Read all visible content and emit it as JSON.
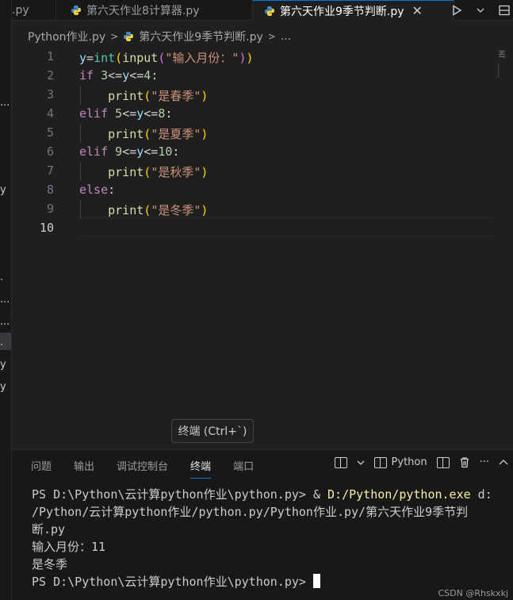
{
  "tabs": [
    {
      "label": ".py"
    },
    {
      "label": "第六天作业8计算器.py"
    },
    {
      "label": "第六天作业9季节判断.py",
      "active": true
    }
  ],
  "left_strip_fragments": [
    "...",
    "y",
    ".",
    "...",
    "...",
    ".",
    "y",
    "y"
  ],
  "breadcrumb": {
    "folder": "Python作业.py",
    "file": "第六天作业9季节判断.py",
    "more": "..."
  },
  "editor": {
    "line_numbers": [
      "1",
      "2",
      "3",
      "4",
      "5",
      "6",
      "7",
      "8",
      "9",
      "10"
    ],
    "current_line": 10,
    "code": {
      "l1_var": "y",
      "l1_eq": "=",
      "l1_int": "int",
      "l1_p1": "(",
      "l1_input": "input",
      "l1_p2": "(",
      "l1_str": "\"输入月份：\"",
      "l1_p3": ")",
      "l1_p4": ")",
      "l2_kw": "if",
      "l2_rest_num1": "3",
      "l2_rest_op1": "<=",
      "l2_rest_var": "y",
      "l2_rest_op2": "<=",
      "l2_rest_num2": "4",
      "l2_colon": ":",
      "l3_fn": "print",
      "l3_str": "\"是春季\"",
      "l4_kw": "elif",
      "l4_num1": "5",
      "l4_num2": "8",
      "l5_str": "\"是夏季\"",
      "l6_kw": "elif",
      "l6_num1": "9",
      "l6_num2": "10",
      "l7_str": "\"是秋季\"",
      "l8_kw": "else",
      "l9_str": "\"是冬季\"",
      "lp": "(",
      "rp": ")"
    },
    "minimap_text": "丟蛋"
  },
  "tooltip": "终端 (Ctrl+`)",
  "panel": {
    "tabs": [
      "问题",
      "输出",
      "调试控制台",
      "终端",
      "端口"
    ],
    "active_tab": "终端",
    "profile_label": "Python",
    "more": "···"
  },
  "terminal": {
    "l1_prompt": "PS D:\\Python\\云计算python作业\\python.py> & ",
    "l1_exe": "D:/Python/python.exe",
    "l1_arg": " d:",
    "l2": "/Python/云计算python作业/python.py/Python作业.py/第六天作业9季节判",
    "l3": "断.py",
    "l4": "输入月份：11",
    "l5": "是冬季",
    "l6": "PS D:\\Python\\云计算python作业\\python.py> "
  },
  "watermark": "CSDN @Rhskxkj",
  "colors": {
    "keyword": "#c586c0",
    "function": "#dcdcaa",
    "string": "#ce9178",
    "number": "#b5cea8",
    "accent": "#0078d4"
  }
}
